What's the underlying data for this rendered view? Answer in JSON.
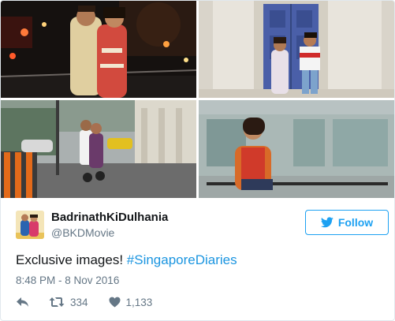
{
  "account": {
    "display_name": "BadrinathKiDulhania",
    "handle": "@BKDMovie"
  },
  "follow_button": {
    "label": "Follow",
    "icon": "twitter-bird-icon"
  },
  "tweet": {
    "text": "Exclusive images! ",
    "hashtag": "#SingaporeDiaries",
    "timestamp": "8:48 PM - 8 Nov 2016"
  },
  "actions": {
    "reply_icon": "reply-icon",
    "retweet_icon": "retweet-icon",
    "retweet_count": "334",
    "like_icon": "heart-icon",
    "like_count": "1,133"
  },
  "colors": {
    "brand_blue": "#1da1f2",
    "link_blue": "#1b95e0",
    "secondary_text": "#657786",
    "border": "#e1e8ed"
  }
}
